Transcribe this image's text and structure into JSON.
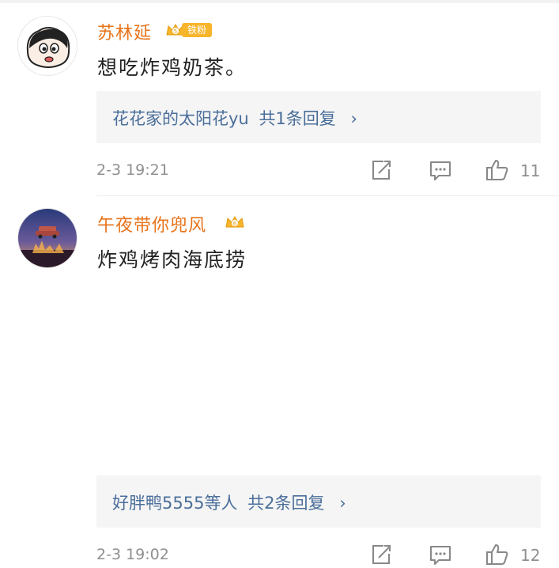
{
  "comments": [
    {
      "username": "苏林延",
      "badge_text": "铁粉",
      "badge_level": "5",
      "content": "想吃炸鸡奶茶。",
      "reply_summary": {
        "names": "花花家的太阳花yu",
        "count_text": "共1条回复",
        "chevron": "›"
      },
      "time": "2-3 19:21",
      "like_count": "11",
      "icons": {
        "share": "share-square-icon",
        "comment": "comment-bubble-icon",
        "like": "thumbs-up-icon"
      }
    },
    {
      "username": "午夜带你兜风",
      "badge_level": "6",
      "content": "炸鸡烤肉海底捞",
      "reply_summary": {
        "names": "好胖鸭5555等人",
        "count_text": "共2条回复",
        "chevron": "›"
      },
      "time": "2-3 19:02",
      "like_count": "12",
      "icons": {
        "share": "share-square-icon",
        "comment": "comment-bubble-icon",
        "like": "thumbs-up-icon"
      }
    }
  ],
  "colors": {
    "username": "#e8731a",
    "reply_link": "#4a6e9a",
    "meta_text": "#8f8f8f",
    "reply_bg": "#f5f5f5",
    "badge_gold": "#f7b52c"
  }
}
